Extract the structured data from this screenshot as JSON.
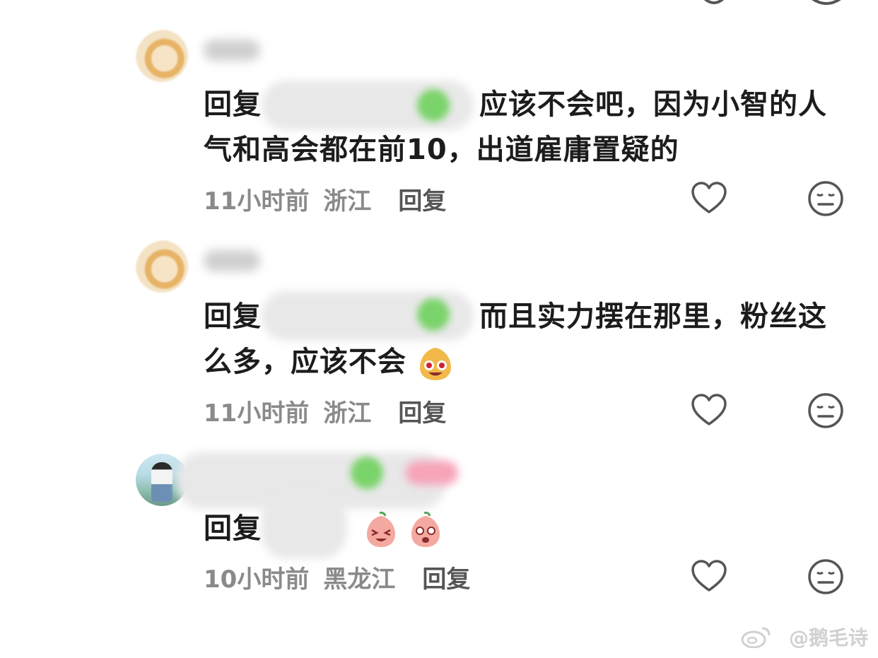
{
  "comments": [
    {
      "reply_prefix": "回复",
      "text_line1": "应该不会吧，因为小智的人",
      "text_line2": "气和高会都在前10，出道雇庸置疑的",
      "time": "11小时前",
      "location": "浙江",
      "reply_label": "回复"
    },
    {
      "reply_prefix": "回复",
      "text_line1": "而且实力摆在那里，粉丝这",
      "text_line2": "么多，应该不会",
      "time": "11小时前",
      "location": "浙江",
      "reply_label": "回复"
    },
    {
      "reply_prefix": "回复",
      "text_line1": "",
      "text_line2": "",
      "time": "10小时前",
      "location": "黑龙江",
      "reply_label": "回复"
    }
  ],
  "watermark": "@鹅毛诗",
  "colors": {
    "meta": "#8a8a8a",
    "text": "#1c1c1c",
    "icon": "#555555"
  },
  "icons": [
    "heart-icon",
    "neutral-face-icon",
    "weibo-logo-icon",
    "peach-emoji-icon"
  ]
}
